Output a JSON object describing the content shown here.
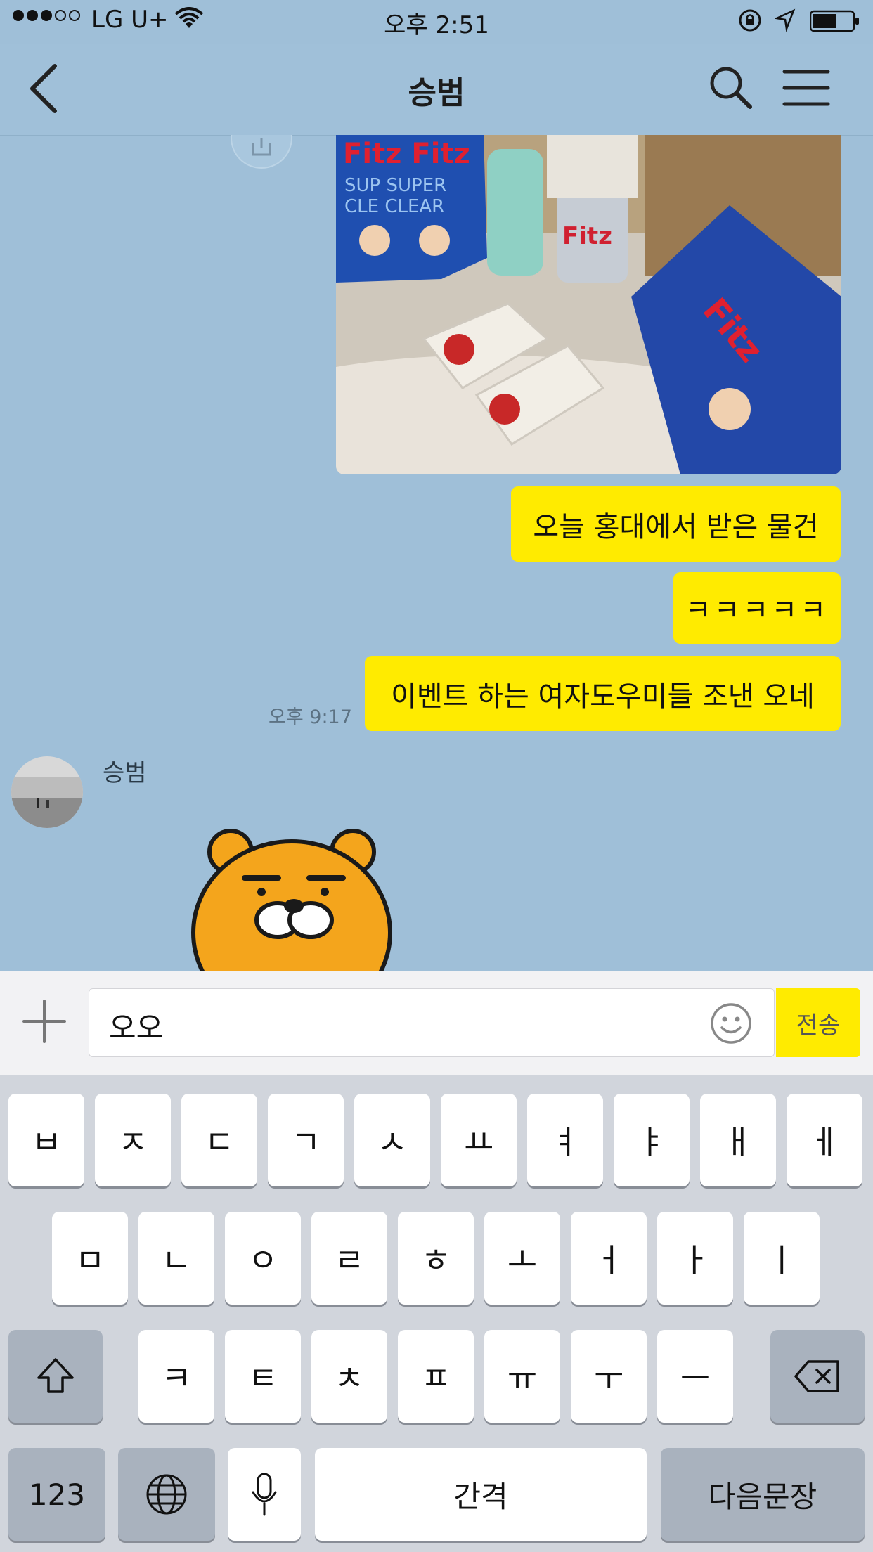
{
  "status_bar": {
    "carrier": "LG U+",
    "time": "오후 2:51"
  },
  "header": {
    "title": "승범",
    "back_icon": "chevron-left-icon",
    "search_icon": "search-icon",
    "menu_icon": "hamburger-menu-icon"
  },
  "messages": [
    {
      "type": "image",
      "from": "me",
      "content": "photo of Fitz promotional items"
    },
    {
      "type": "text",
      "from": "me",
      "text": "오늘 홍대에서 받은 물건"
    },
    {
      "type": "text",
      "from": "me",
      "text": "ㅋㅋㅋㅋㅋ"
    },
    {
      "type": "text",
      "from": "me",
      "text": "이벤트 하는 여자도우미들 조낸 오네"
    }
  ],
  "timestamp": "오후 9:17",
  "incoming": {
    "sender": "승범",
    "sticker": "ryan-bear-sticker"
  },
  "input": {
    "value": "오오",
    "send_label": "전송"
  },
  "keyboard": {
    "row1": [
      "ㅂ",
      "ㅈ",
      "ㄷ",
      "ㄱ",
      "ㅅ",
      "ㅛ",
      "ㅕ",
      "ㅑ",
      "ㅐ",
      "ㅔ"
    ],
    "row2": [
      "ㅁ",
      "ㄴ",
      "ㅇ",
      "ㄹ",
      "ㅎ",
      "ㅗ",
      "ㅓ",
      "ㅏ",
      "ㅣ"
    ],
    "row3": [
      "ㅋ",
      "ㅌ",
      "ㅊ",
      "ㅍ",
      "ㅠ",
      "ㅜ",
      "ㅡ"
    ],
    "numbers_label": "123",
    "space_label": "간격",
    "return_label": "다음문장"
  },
  "colors": {
    "chat_background": "#9fbfd8",
    "my_bubble": "#ffeb00",
    "send_button": "#ffeb00"
  }
}
